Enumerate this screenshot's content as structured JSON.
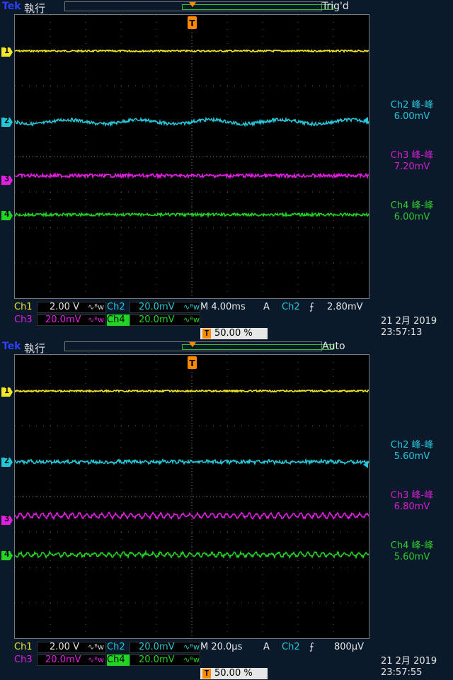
{
  "screens": [
    {
      "brand": "Tek",
      "run_state": "執行",
      "trigger_status": "Trig'd",
      "measurements": [
        {
          "label": "Ch2 峰-峰",
          "value": "6.00mV",
          "color": "#26c6d9"
        },
        {
          "label": "Ch3 峰-峰",
          "value": "7.20mV",
          "color": "#d21fd2"
        },
        {
          "label": "Ch4 峰-峰",
          "value": "6.00mV",
          "color": "#2ec82e"
        }
      ],
      "channel_markers": [
        "1",
        "2",
        "3",
        "4"
      ],
      "settings": {
        "ch1_label": "Ch1",
        "ch1_scale": "2.00 V",
        "ch2_label": "Ch2",
        "ch2_scale": "20.0mV",
        "ch3_label": "Ch3",
        "ch3_scale": "20.0mV",
        "ch4_label": "Ch4",
        "ch4_scale": "20.0mV",
        "bw_symbol": "∿ᴮw",
        "timebase": "M 4.00ms",
        "trigger_mode": "A",
        "trigger_source": "Ch2",
        "trigger_level": "2.80mV",
        "trigger_position_badge": "T",
        "trigger_position": "50.00 %"
      },
      "date": "21 2月  2019",
      "time": "23:57:13"
    },
    {
      "brand": "Tek",
      "run_state": "執行",
      "trigger_status": "Auto",
      "measurements": [
        {
          "label": "Ch2 峰-峰",
          "value": "5.60mV",
          "color": "#26c6d9"
        },
        {
          "label": "Ch3 峰-峰",
          "value": "6.80mV",
          "color": "#d21fd2"
        },
        {
          "label": "Ch4 峰-峰",
          "value": "5.60mV",
          "color": "#2ec82e"
        }
      ],
      "channel_markers": [
        "1",
        "2",
        "3",
        "4"
      ],
      "settings": {
        "ch1_label": "Ch1",
        "ch1_scale": "2.00 V",
        "ch2_label": "Ch2",
        "ch2_scale": "20.0mV",
        "ch3_label": "Ch3",
        "ch3_scale": "20.0mV",
        "ch4_label": "Ch4",
        "ch4_scale": "20.0mV",
        "bw_symbol": "∿ᴮw",
        "timebase": "M 20.0µs",
        "trigger_mode": "A",
        "trigger_source": "Ch2",
        "trigger_level": "800µV",
        "trigger_position_badge": "T",
        "trigger_position": "50.00 %"
      },
      "date": "21 2月  2019",
      "time": "23:57:55"
    }
  ],
  "colors": {
    "ch1": "#f2e62a",
    "ch2": "#26c6d9",
    "ch3": "#e21ee2",
    "ch4": "#22d422",
    "trigger_marker": "#ff8a00",
    "background": "#0b1a2a",
    "grid": "#000000"
  }
}
